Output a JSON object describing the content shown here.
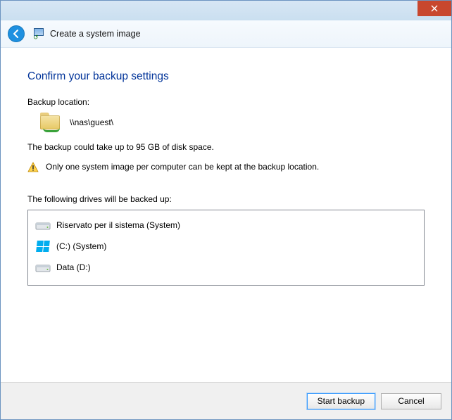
{
  "header": {
    "title": "Create a system image"
  },
  "page": {
    "heading": "Confirm your backup settings",
    "location_label": "Backup location:",
    "location_path": "\\\\nas\\guest\\",
    "size_estimate": "The backup could take up to 95 GB of disk space.",
    "warning": "Only one system image per computer can be kept at the backup location.",
    "drives_label": "The following drives will be backed up:",
    "drives": [
      {
        "name": "Riservato per il sistema (System)",
        "icon": "hdd"
      },
      {
        "name": "(C:) (System)",
        "icon": "winflag"
      },
      {
        "name": "Data (D:)",
        "icon": "hdd"
      }
    ]
  },
  "footer": {
    "start_label": "Start backup",
    "cancel_label": "Cancel"
  }
}
